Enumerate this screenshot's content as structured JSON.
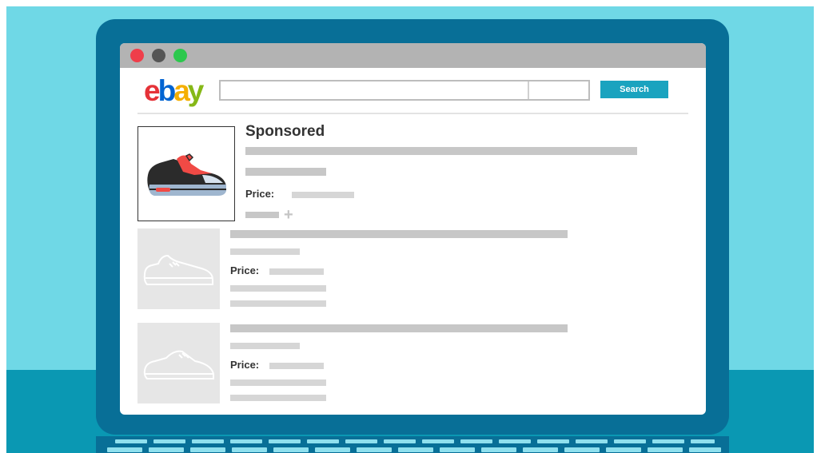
{
  "colors": {
    "wall": "#6fd8e6",
    "desk": "#0a98b3",
    "laptop_bezel": "#086f97",
    "accent": "#1aa3bf",
    "sponsored_shoe": "#f04a45"
  },
  "browser": {
    "controls": [
      "close",
      "minimize",
      "maximize"
    ]
  },
  "header": {
    "logo": {
      "e": "e",
      "b": "b",
      "a": "a",
      "y": "y"
    },
    "search": {
      "input_value": "",
      "button_label": "Search"
    }
  },
  "listings": [
    {
      "badge": "Sponsored",
      "price_label": "Price:",
      "icon": "sneaker-icon-color",
      "extra": "plus-icon"
    },
    {
      "price_label": "Price:",
      "icon": "sneaker-icon-outline"
    },
    {
      "price_label": "Price:",
      "icon": "sneaker-icon-outline"
    }
  ]
}
